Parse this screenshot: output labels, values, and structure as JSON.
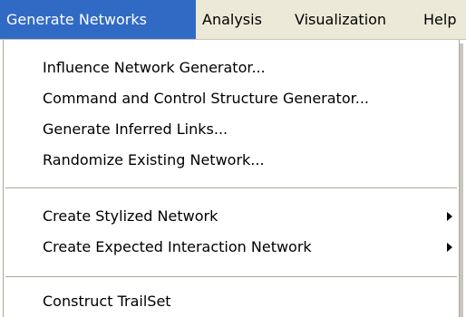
{
  "menubar": {
    "menus": [
      {
        "label": "Generate Networks"
      },
      {
        "label": "Analysis"
      },
      {
        "label": "Visualization"
      },
      {
        "label": "Help"
      }
    ]
  },
  "dropdown": {
    "items": [
      {
        "label": "Influence Network Generator..."
      },
      {
        "label": "Command and Control Structure Generator..."
      },
      {
        "label": "Generate Inferred Links..."
      },
      {
        "label": "Randomize Existing Network..."
      },
      {
        "label": "Create Stylized Network"
      },
      {
        "label": "Create Expected Interaction Network"
      },
      {
        "label": "Construct TrailSet"
      }
    ]
  },
  "colors": {
    "menubar_bg": "#ece9d8",
    "highlight_bg": "#316ac5",
    "highlight_text": "#ffffff",
    "menu_bg": "#ffffff",
    "separator": "#aca899"
  },
  "icons": {
    "submenu_arrow": "chevron-right-icon"
  }
}
